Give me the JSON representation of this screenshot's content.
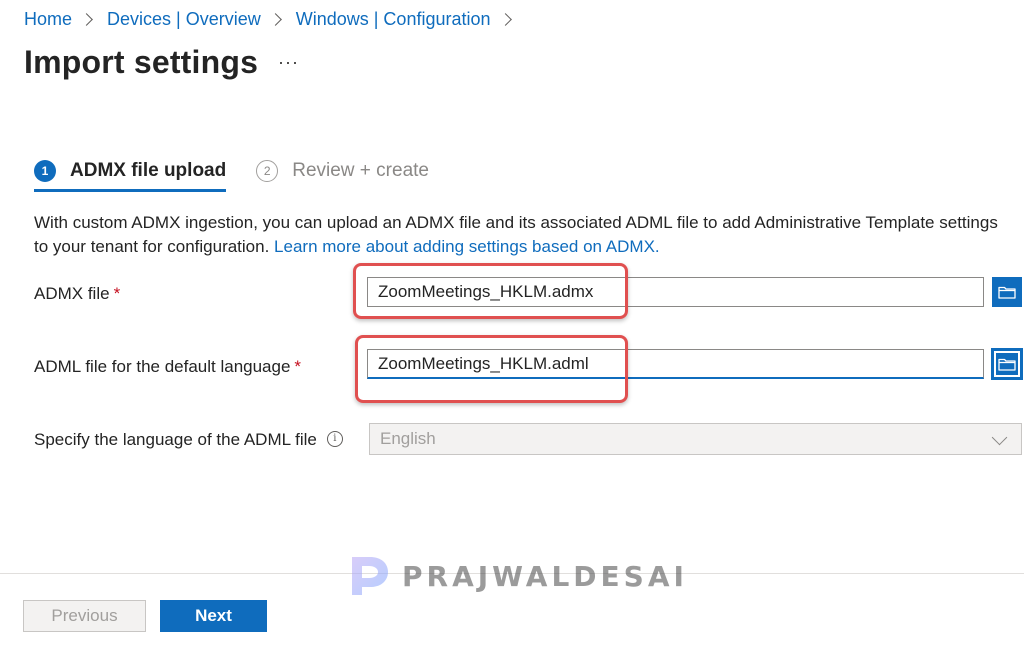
{
  "breadcrumb": [
    {
      "label": "Home"
    },
    {
      "label": "Devices | Overview"
    },
    {
      "label": "Windows | Configuration"
    }
  ],
  "page": {
    "title": "Import settings",
    "more_label": "···"
  },
  "steps": [
    {
      "number": "1",
      "label": "ADMX file upload",
      "state": "active"
    },
    {
      "number": "2",
      "label": "Review + create",
      "state": "inactive"
    }
  ],
  "description": {
    "text": "With custom ADMX ingestion, you can upload an ADMX file and its associated ADML file to add Administrative Template settings to your tenant for configuration. ",
    "line1": "With custom ADMX ingestion, you can upload an ADMX file and its associated ADML file to add Administrative Template settings",
    "line2": "to your tenant for configuration. ",
    "link": "Learn more about adding settings based on ADMX."
  },
  "form": {
    "admx_label": "ADMX file",
    "admx_value": "ZoomMeetings_HKLM.admx",
    "adml_label": "ADML file for the default language",
    "adml_value": "ZoomMeetings_HKLM.adml",
    "language_label": "Specify the language of the ADML file",
    "language_value": "English",
    "required_mark": "*"
  },
  "footer": {
    "previous_label": "Previous",
    "next_label": "Next"
  },
  "watermark": {
    "text": "PRAJWALDESAI",
    "logo_letter": "P"
  },
  "colors": {
    "accent": "#0f6cbd",
    "required": "#c50f1f",
    "annotation": "#e05050"
  }
}
